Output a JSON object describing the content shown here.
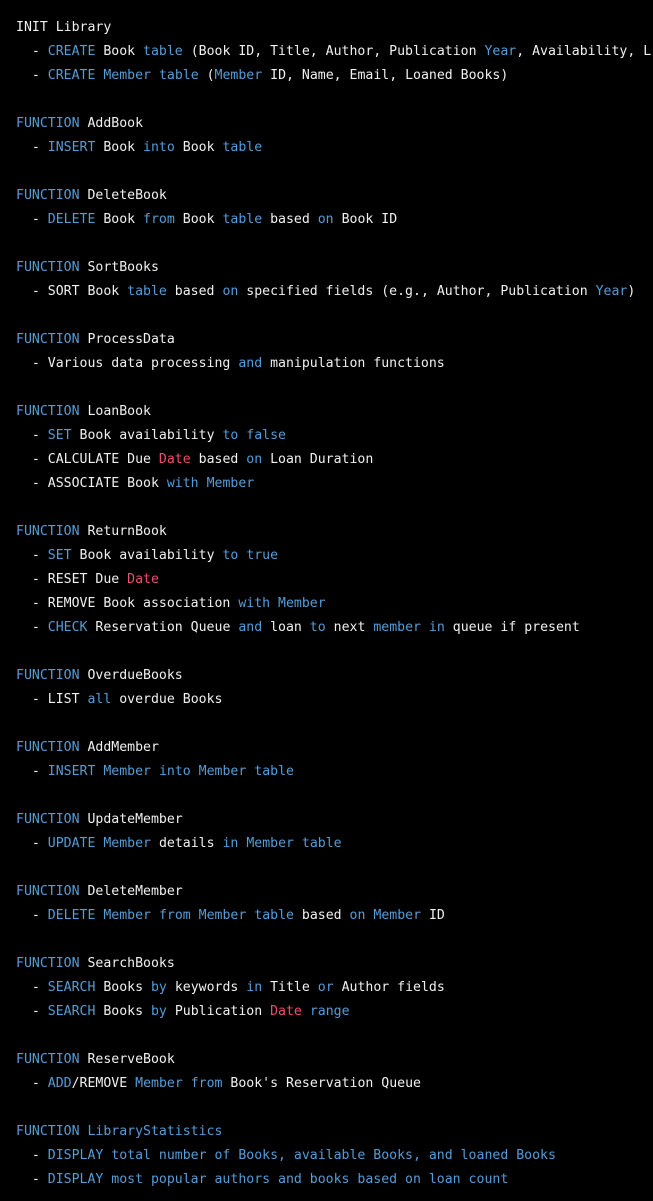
{
  "colors": {
    "background": "#000000",
    "text": "#f0f0f0",
    "keyword": "#569cd6",
    "highlight": "#f14c6e"
  },
  "lines": [
    [
      [
        "t",
        "INIT Library"
      ]
    ],
    [
      [
        "t",
        "  - "
      ],
      [
        "k",
        "CREATE"
      ],
      [
        "t",
        " Book "
      ],
      [
        "k",
        "table"
      ],
      [
        "t",
        " (Book ID, Title, Author, Publication "
      ],
      [
        "k",
        "Year"
      ],
      [
        "t",
        ", Availability, L"
      ]
    ],
    [
      [
        "t",
        "  - "
      ],
      [
        "k",
        "CREATE"
      ],
      [
        "t",
        " "
      ],
      [
        "k",
        "Member"
      ],
      [
        "t",
        " "
      ],
      [
        "k",
        "table"
      ],
      [
        "t",
        " ("
      ],
      [
        "k",
        "Member"
      ],
      [
        "t",
        " ID, Name, Email, Loaned Books)"
      ]
    ],
    [],
    [
      [
        "k",
        "FUNCTION"
      ],
      [
        "t",
        " AddBook"
      ]
    ],
    [
      [
        "t",
        "  - "
      ],
      [
        "k",
        "INSERT"
      ],
      [
        "t",
        " Book "
      ],
      [
        "k",
        "into"
      ],
      [
        "t",
        " Book "
      ],
      [
        "k",
        "table"
      ]
    ],
    [],
    [
      [
        "k",
        "FUNCTION"
      ],
      [
        "t",
        " DeleteBook"
      ]
    ],
    [
      [
        "t",
        "  - "
      ],
      [
        "k",
        "DELETE"
      ],
      [
        "t",
        " Book "
      ],
      [
        "k",
        "from"
      ],
      [
        "t",
        " Book "
      ],
      [
        "k",
        "table"
      ],
      [
        "t",
        " based "
      ],
      [
        "k",
        "on"
      ],
      [
        "t",
        " Book ID"
      ]
    ],
    [],
    [
      [
        "k",
        "FUNCTION"
      ],
      [
        "t",
        " SortBooks"
      ]
    ],
    [
      [
        "t",
        "  - SORT Book "
      ],
      [
        "k",
        "table"
      ],
      [
        "t",
        " based "
      ],
      [
        "k",
        "on"
      ],
      [
        "t",
        " specified fields (e.g., Author, Publication "
      ],
      [
        "k",
        "Year"
      ],
      [
        "t",
        ")"
      ]
    ],
    [],
    [
      [
        "k",
        "FUNCTION"
      ],
      [
        "t",
        " ProcessData"
      ]
    ],
    [
      [
        "t",
        "  - Various data processing "
      ],
      [
        "k",
        "and"
      ],
      [
        "t",
        " manipulation functions"
      ]
    ],
    [],
    [
      [
        "k",
        "FUNCTION"
      ],
      [
        "t",
        " LoanBook"
      ]
    ],
    [
      [
        "t",
        "  - "
      ],
      [
        "k",
        "SET"
      ],
      [
        "t",
        " Book availability "
      ],
      [
        "k",
        "to"
      ],
      [
        "t",
        " "
      ],
      [
        "k",
        "false"
      ]
    ],
    [
      [
        "t",
        "  - CALCULATE Due "
      ],
      [
        "r",
        "Date"
      ],
      [
        "t",
        " based "
      ],
      [
        "k",
        "on"
      ],
      [
        "t",
        " Loan Duration"
      ]
    ],
    [
      [
        "t",
        "  - ASSOCIATE Book "
      ],
      [
        "k",
        "with"
      ],
      [
        "t",
        " "
      ],
      [
        "k",
        "Member"
      ]
    ],
    [],
    [
      [
        "k",
        "FUNCTION"
      ],
      [
        "t",
        " ReturnBook"
      ]
    ],
    [
      [
        "t",
        "  - "
      ],
      [
        "k",
        "SET"
      ],
      [
        "t",
        " Book availability "
      ],
      [
        "k",
        "to"
      ],
      [
        "t",
        " "
      ],
      [
        "k",
        "true"
      ]
    ],
    [
      [
        "t",
        "  - RESET Due "
      ],
      [
        "r",
        "Date"
      ]
    ],
    [
      [
        "t",
        "  - REMOVE Book association "
      ],
      [
        "k",
        "with"
      ],
      [
        "t",
        " "
      ],
      [
        "k",
        "Member"
      ]
    ],
    [
      [
        "t",
        "  - "
      ],
      [
        "k",
        "CHECK"
      ],
      [
        "t",
        " Reservation Queue "
      ],
      [
        "k",
        "and"
      ],
      [
        "t",
        " loan "
      ],
      [
        "k",
        "to"
      ],
      [
        "t",
        " next "
      ],
      [
        "k",
        "member"
      ],
      [
        "t",
        " "
      ],
      [
        "k",
        "in"
      ],
      [
        "t",
        " queue if present"
      ]
    ],
    [],
    [
      [
        "k",
        "FUNCTION"
      ],
      [
        "t",
        " OverdueBooks"
      ]
    ],
    [
      [
        "t",
        "  - LIST "
      ],
      [
        "k",
        "all"
      ],
      [
        "t",
        " overdue Books"
      ]
    ],
    [],
    [
      [
        "k",
        "FUNCTION"
      ],
      [
        "t",
        " AddMember"
      ]
    ],
    [
      [
        "t",
        "  - "
      ],
      [
        "k",
        "INSERT"
      ],
      [
        "t",
        " "
      ],
      [
        "k",
        "Member"
      ],
      [
        "t",
        " "
      ],
      [
        "k",
        "into"
      ],
      [
        "t",
        " "
      ],
      [
        "k",
        "Member"
      ],
      [
        "t",
        " "
      ],
      [
        "k",
        "table"
      ]
    ],
    [],
    [
      [
        "k",
        "FUNCTION"
      ],
      [
        "t",
        " UpdateMember"
      ]
    ],
    [
      [
        "t",
        "  - "
      ],
      [
        "k",
        "UPDATE"
      ],
      [
        "t",
        " "
      ],
      [
        "k",
        "Member"
      ],
      [
        "t",
        " details "
      ],
      [
        "k",
        "in"
      ],
      [
        "t",
        " "
      ],
      [
        "k",
        "Member"
      ],
      [
        "t",
        " "
      ],
      [
        "k",
        "table"
      ]
    ],
    [],
    [
      [
        "k",
        "FUNCTION"
      ],
      [
        "t",
        " DeleteMember"
      ]
    ],
    [
      [
        "t",
        "  - "
      ],
      [
        "k",
        "DELETE"
      ],
      [
        "t",
        " "
      ],
      [
        "k",
        "Member"
      ],
      [
        "t",
        " "
      ],
      [
        "k",
        "from"
      ],
      [
        "t",
        " "
      ],
      [
        "k",
        "Member"
      ],
      [
        "t",
        " "
      ],
      [
        "k",
        "table"
      ],
      [
        "t",
        " based "
      ],
      [
        "k",
        "on"
      ],
      [
        "t",
        " "
      ],
      [
        "k",
        "Member"
      ],
      [
        "t",
        " ID"
      ]
    ],
    [],
    [
      [
        "k",
        "FUNCTION"
      ],
      [
        "t",
        " SearchBooks"
      ]
    ],
    [
      [
        "t",
        "  - "
      ],
      [
        "k",
        "SEARCH"
      ],
      [
        "t",
        " Books "
      ],
      [
        "k",
        "by"
      ],
      [
        "t",
        " keywords "
      ],
      [
        "k",
        "in"
      ],
      [
        "t",
        " Title "
      ],
      [
        "k",
        "or"
      ],
      [
        "t",
        " Author fields"
      ]
    ],
    [
      [
        "t",
        "  - "
      ],
      [
        "k",
        "SEARCH"
      ],
      [
        "t",
        " Books "
      ],
      [
        "k",
        "by"
      ],
      [
        "t",
        " Publication "
      ],
      [
        "r",
        "Date"
      ],
      [
        "t",
        " "
      ],
      [
        "k",
        "range"
      ]
    ],
    [],
    [
      [
        "k",
        "FUNCTION"
      ],
      [
        "t",
        " ReserveBook"
      ]
    ],
    [
      [
        "t",
        "  - "
      ],
      [
        "k",
        "ADD"
      ],
      [
        "t",
        "/REMOVE "
      ],
      [
        "k",
        "Member"
      ],
      [
        "t",
        " "
      ],
      [
        "k",
        "from"
      ],
      [
        "t",
        " Book's Reservation Queue"
      ]
    ],
    [],
    [
      [
        "k",
        "FUNCTION LibraryStatistics"
      ]
    ],
    [
      [
        "t",
        "  - "
      ],
      [
        "k",
        "DISPLAY total number of Books, available Books, and loaned Books"
      ]
    ],
    [
      [
        "t",
        "  - "
      ],
      [
        "k",
        "DISPLAY most popular authors and books based on loan count"
      ]
    ]
  ]
}
